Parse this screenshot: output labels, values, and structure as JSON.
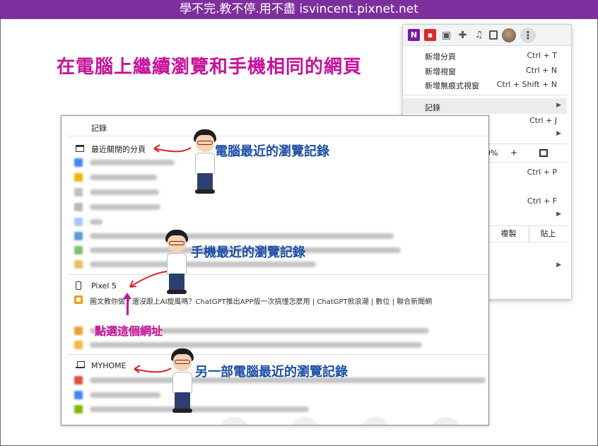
{
  "banner": {
    "text": "學不完.教不停.用不盡 isvincent.pixnet.net"
  },
  "headline": "在電腦上繼續瀏覽和手機相同的網頁",
  "chrome_menu": {
    "items": {
      "new_tab": {
        "label": "新增分頁",
        "shortcut": "Ctrl + T"
      },
      "new_window": {
        "label": "新增視窗",
        "shortcut": "Ctrl + N"
      },
      "new_incognito": {
        "label": "新增無痕式視窗",
        "shortcut": "Ctrl + Shift + N"
      },
      "history": {
        "label": "記錄",
        "arrow": "▶"
      }
    },
    "partial": {
      "shortcut_j": "Ctrl + J",
      "zoom_pct": "0%",
      "zoom_plus": "+",
      "shortcut_p": "Ctrl + P",
      "shortcut_f": "Ctrl + F",
      "copy": "複製",
      "paste": "貼上",
      "arrow": "▶"
    }
  },
  "history_panel": {
    "title": "記錄",
    "section_recent": "最近關閉的分頁",
    "section_phone": "Pixel 5",
    "phone_entry": "圖文教你做 / 還沒跟上AI旋風嗎？ChatGPT推出APP版一次搞懂怎麼用 | ChatGPT掀浪潮 | 數位 | 聯合新聞網",
    "section_pc": "MYHOME"
  },
  "annotations": {
    "pc_history": "電腦最近的瀏覽記錄",
    "phone_history": "手機最近的瀏覽記錄",
    "click_url": "點選這個網址",
    "other_pc_history": "另一部電腦最近的瀏覽記錄"
  },
  "colors": {
    "banner_bg": "#7d2f9e",
    "headline": "#c8119a",
    "annotation_blue": "#1b4fa8",
    "annotation_pink": "#c8119a"
  }
}
